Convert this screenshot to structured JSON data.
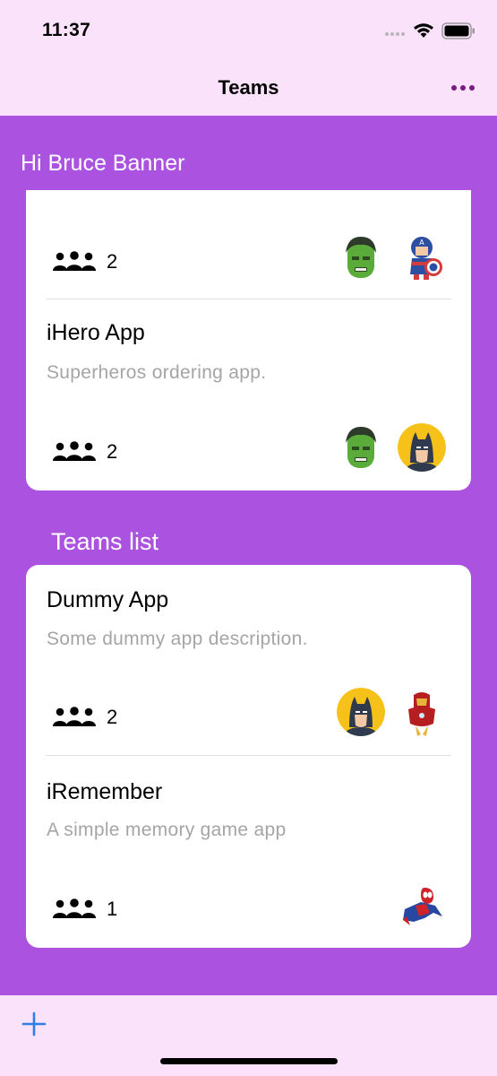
{
  "status_bar": {
    "time": "11:37"
  },
  "nav": {
    "title": "Teams"
  },
  "greeting": "Hi Bruce Banner",
  "top_card": {
    "teams": [
      {
        "name": "",
        "description": "",
        "member_count": "2",
        "avatars": [
          "hulk-avatar",
          "captain-america-avatar"
        ]
      },
      {
        "name": "iHero App",
        "description": "Superheros ordering app.",
        "member_count": "2",
        "avatars": [
          "hulk-avatar",
          "batman-avatar"
        ]
      }
    ]
  },
  "teams_list": {
    "title": "Teams list",
    "teams": [
      {
        "name": "Dummy App",
        "description": "Some dummy app description.",
        "member_count": "2",
        "avatars": [
          "batman-avatar",
          "iron-man-avatar"
        ]
      },
      {
        "name": "iRemember",
        "description": "A simple memory game app",
        "member_count": "1",
        "avatars": [
          "spider-man-avatar"
        ]
      }
    ]
  },
  "toolbar": {
    "add_icon": "plus-icon"
  },
  "colors": {
    "background": "#ab52e0",
    "bar": "#fbe2fb",
    "accent": "#2f7ee6",
    "more_dots": "#7a1a7e"
  }
}
